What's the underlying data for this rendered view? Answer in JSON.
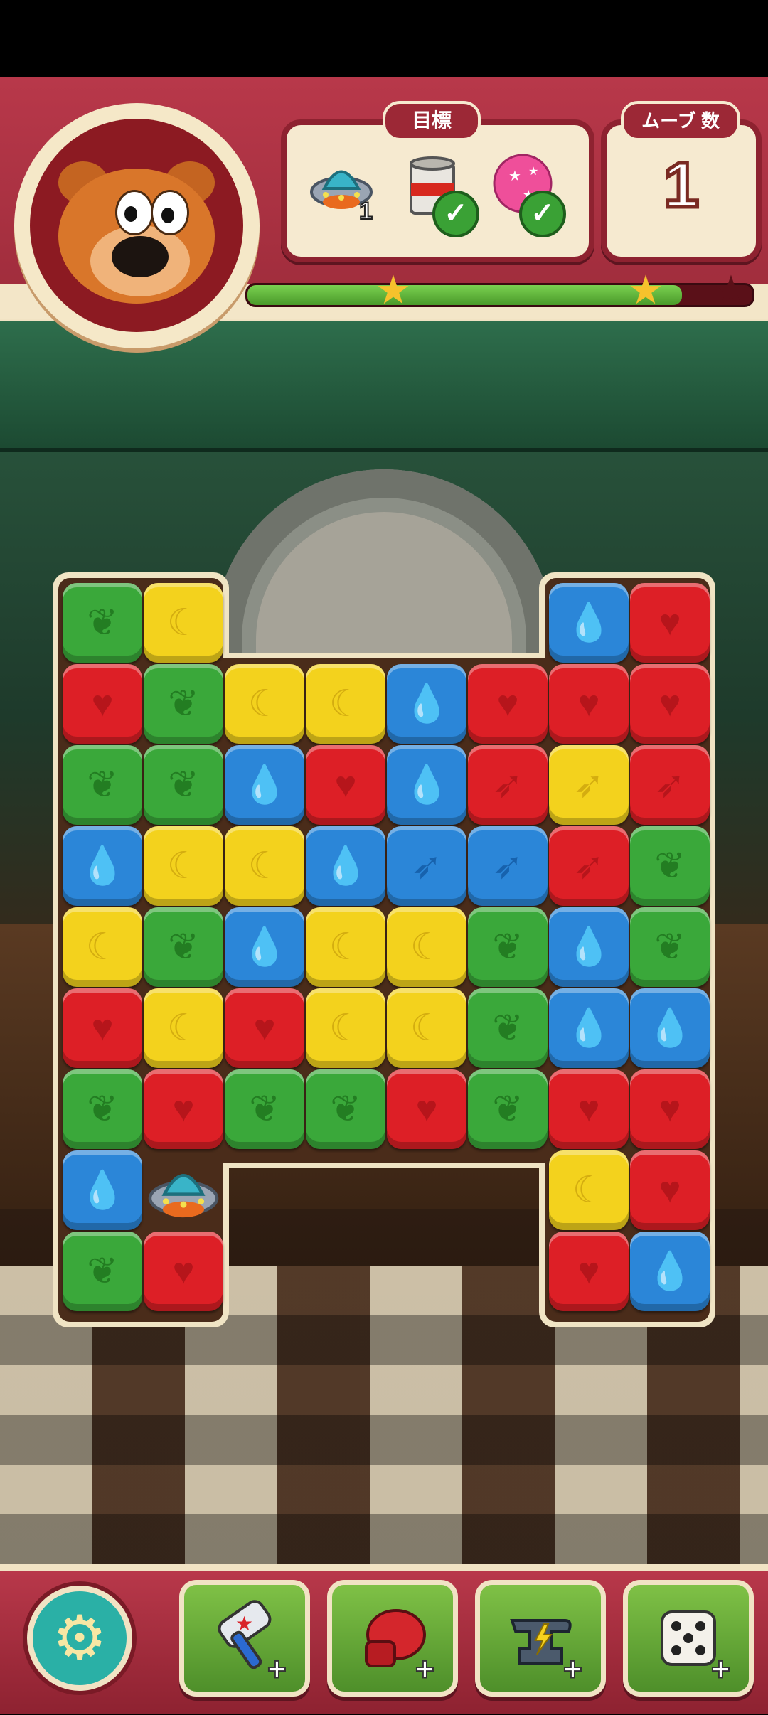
{
  "hud": {
    "goal_label": "目標",
    "moves_label": "ムーブ 数",
    "moves_value": "1",
    "goals": [
      {
        "icon": "ufo-icon",
        "count": "1",
        "done": false
      },
      {
        "icon": "paint-can-icon",
        "done": true
      },
      {
        "icon": "pink-balloon-icon",
        "done": true
      }
    ],
    "progress": 0.86,
    "stars_earned": 2,
    "stars_total": 3
  },
  "board": {
    "rows": 9,
    "cols": 8,
    "grid": [
      [
        "green",
        "yellow",
        null,
        null,
        null,
        null,
        "blue",
        "red"
      ],
      [
        "red",
        "green",
        "yellow",
        "yellow",
        "blue",
        "red",
        "red",
        "red"
      ],
      [
        "green",
        "green",
        "blue",
        "red",
        "blue",
        "red",
        "yellow",
        "red"
      ],
      [
        "blue",
        "yellow",
        "yellow",
        "blue",
        "blue",
        "blue",
        "red",
        "green"
      ],
      [
        "yellow",
        "green",
        "blue",
        "yellow",
        "yellow",
        "green",
        "blue",
        "green"
      ],
      [
        "red",
        "yellow",
        "red",
        "yellow",
        "yellow",
        "green",
        "blue",
        "blue"
      ],
      [
        "green",
        "red",
        "green",
        "green",
        "red",
        "green",
        "red",
        "red"
      ],
      [
        "blue",
        "ufo",
        null,
        null,
        null,
        null,
        "yellow",
        "red"
      ],
      [
        "green",
        "red",
        null,
        null,
        null,
        null,
        "red",
        "blue"
      ]
    ],
    "symbols": {
      "red": "heart",
      "green": "leaf",
      "yellow": "moon",
      "blue": "drop"
    },
    "special_blocks": {
      "2-5": "rocket",
      "2-6": "rocket",
      "2-7": "rocket",
      "3-4": "rocket",
      "3-5": "rocket",
      "3-6": "rocket"
    }
  },
  "boosters": [
    {
      "name": "hammer-booster",
      "icon": "hammer-icon"
    },
    {
      "name": "boxing-glove-booster",
      "icon": "boxing-glove-icon"
    },
    {
      "name": "anvil-booster",
      "icon": "anvil-icon"
    },
    {
      "name": "dice-booster",
      "icon": "dice-icon"
    }
  ],
  "colors": {
    "red": "#dd1f26",
    "green": "#3aa83a",
    "yellow": "#f3d21d",
    "blue": "#2b86d8",
    "hud": "#b8384a"
  }
}
